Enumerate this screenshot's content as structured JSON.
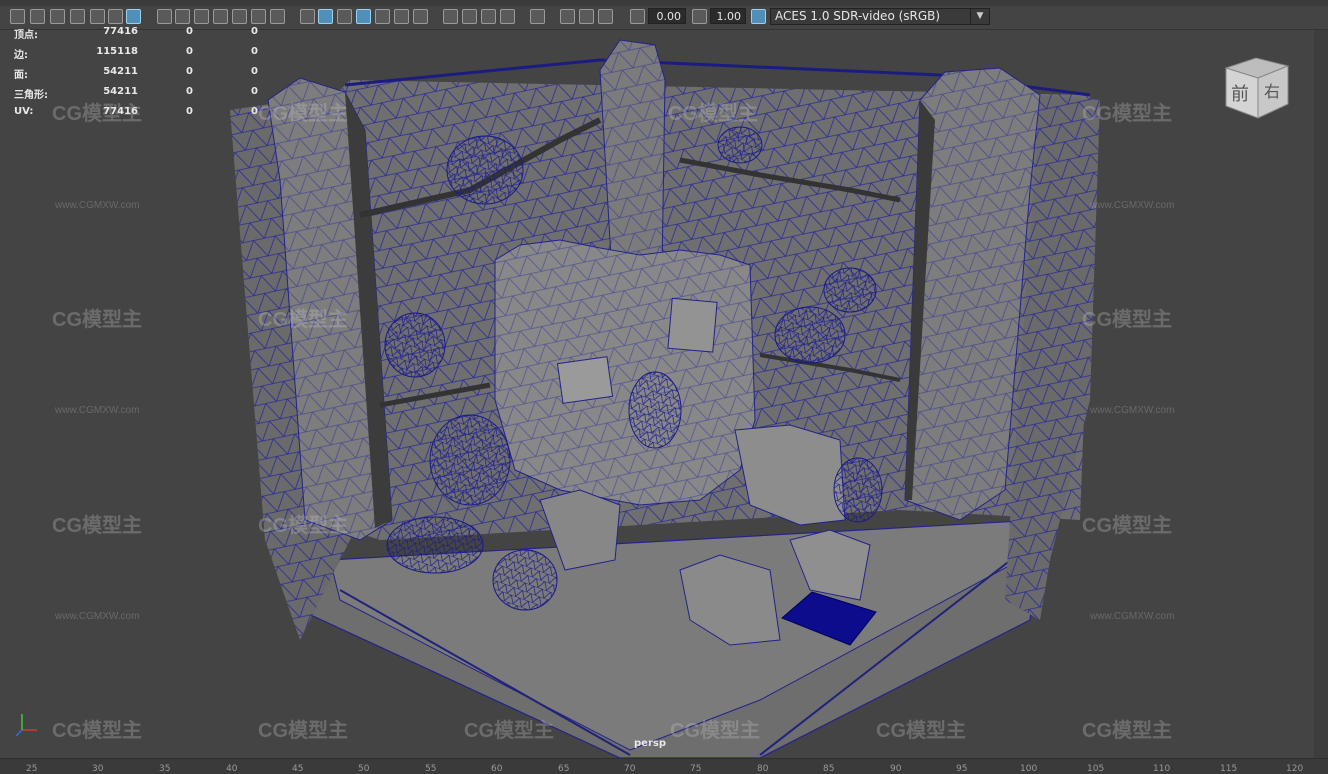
{
  "toolbar": {
    "exposure_value": "0.00",
    "gamma_value": "1.00",
    "colorspace": "ACES 1.0 SDR-video (sRGB)",
    "icons": [
      "camera-icon",
      "camera-attr-icon",
      "bookmark-icon",
      "grid-icon",
      "film-gate-icon",
      "resolution-gate-icon",
      "wireframe-icon",
      "smooth-shade-icon",
      "textured-icon",
      "lighting-icon",
      "shadows-icon",
      "isolate-icon",
      "xray-icon"
    ]
  },
  "hud": {
    "rows": [
      {
        "label": "顶点:",
        "v1": "77416",
        "v2": "0",
        "v3": "0"
      },
      {
        "label": "边:",
        "v1": "115118",
        "v2": "0",
        "v3": "0"
      },
      {
        "label": "面:",
        "v1": "54211",
        "v2": "0",
        "v3": "0"
      },
      {
        "label": "三角形:",
        "v1": "54211",
        "v2": "0",
        "v3": "0"
      },
      {
        "label": "UV:",
        "v1": "77416",
        "v2": "0",
        "v3": "0"
      }
    ]
  },
  "viewcube": {
    "front": "前",
    "right": "右"
  },
  "camera_label": "persp",
  "axis": {
    "x": "x",
    "y": "y",
    "z": "z"
  },
  "ruler": [
    "25",
    "30",
    "35",
    "40",
    "45",
    "50",
    "55",
    "60",
    "65",
    "70",
    "75",
    "80",
    "85",
    "90",
    "95",
    "100",
    "105",
    "110",
    "115",
    "120"
  ],
  "watermark": {
    "text": "CG模型主",
    "url": "www.CGMXW.com"
  },
  "colors": {
    "wire": "#2a2a9a",
    "shaded": "#7a7a7a",
    "bg": "#444444",
    "highlight": "#0c0c8c"
  }
}
